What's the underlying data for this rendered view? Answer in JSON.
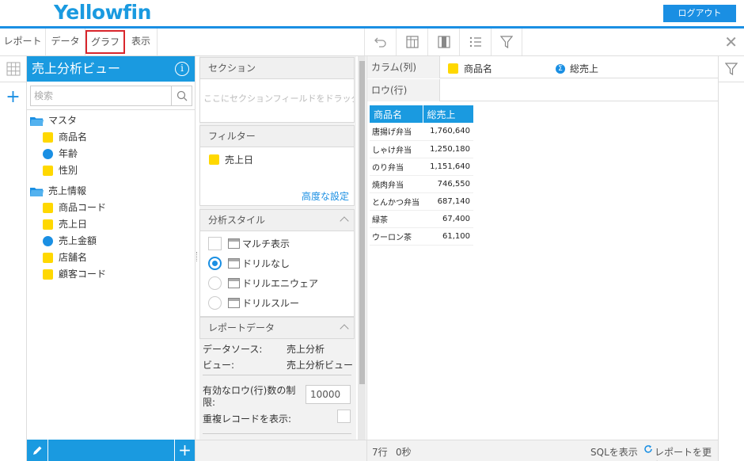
{
  "header": {
    "logo": "Yellowfin",
    "logout_label": "ログアウト"
  },
  "toolbar": {
    "tabs": [
      "レポート",
      "データ",
      "グラフ",
      "表示"
    ]
  },
  "data_panel": {
    "title": "売上分析ビュー",
    "search_placeholder": "検索",
    "folders": [
      {
        "name": "マスタ",
        "fields": [
          {
            "name": "商品名",
            "kind": "dimension"
          },
          {
            "name": "年齢",
            "kind": "metric"
          },
          {
            "name": "性別",
            "kind": "dimension"
          }
        ]
      },
      {
        "name": "売上情報",
        "fields": [
          {
            "name": "商品コード",
            "kind": "dimension"
          },
          {
            "name": "売上日",
            "kind": "dimension"
          },
          {
            "name": "売上金額",
            "kind": "metric"
          },
          {
            "name": "店舗名",
            "kind": "dimension"
          },
          {
            "name": "顧客コード",
            "kind": "dimension"
          }
        ]
      }
    ]
  },
  "mid": {
    "section_title": "セクション",
    "section_hint": "ここにセクションフィールドをドラッグ",
    "filter_title": "フィルター",
    "filter_item": "売上日",
    "advanced_link": "高度な設定",
    "style_title": "分析スタイル",
    "styles": [
      "マルチ表示",
      "ドリルなし",
      "ドリルエニウェア",
      "ドリルスルー"
    ],
    "report_data_title": "レポートデータ",
    "data_source_label": "データソース:",
    "data_source_value": "売上分析",
    "view_label": "ビュー:",
    "view_value": "売上分析ビュー",
    "row_limit_label_1": "有効なロウ(行)数の制",
    "row_limit_label_2": "限:",
    "row_limit_value": "10000",
    "dup_label": "重複レコードを表示:"
  },
  "report": {
    "column_label": "カラム(列)",
    "row_label": "ロウ(行)",
    "column_fields": [
      "商品名",
      "総売上"
    ],
    "table": {
      "headers": [
        "商品名",
        "総売上"
      ],
      "rows": [
        [
          "唐揚げ弁当",
          "1,760,640"
        ],
        [
          "しゃけ弁当",
          "1,250,180"
        ],
        [
          "のり弁当",
          "1,151,640"
        ],
        [
          "焼肉弁当",
          "746,550"
        ],
        [
          "とんかつ弁当",
          "687,140"
        ],
        [
          "緑茶",
          "67,400"
        ],
        [
          "ウーロン茶",
          "61,100"
        ]
      ]
    },
    "footer_rows": "7行",
    "footer_time": "0秒",
    "sql_label": "SQLを表示",
    "refresh_label": "レポートを更新"
  },
  "colors": {
    "accent": "#1a9ae0",
    "dimension": "#ffd800",
    "metric": "#1a8fe3",
    "highlight": "#d9262c"
  }
}
